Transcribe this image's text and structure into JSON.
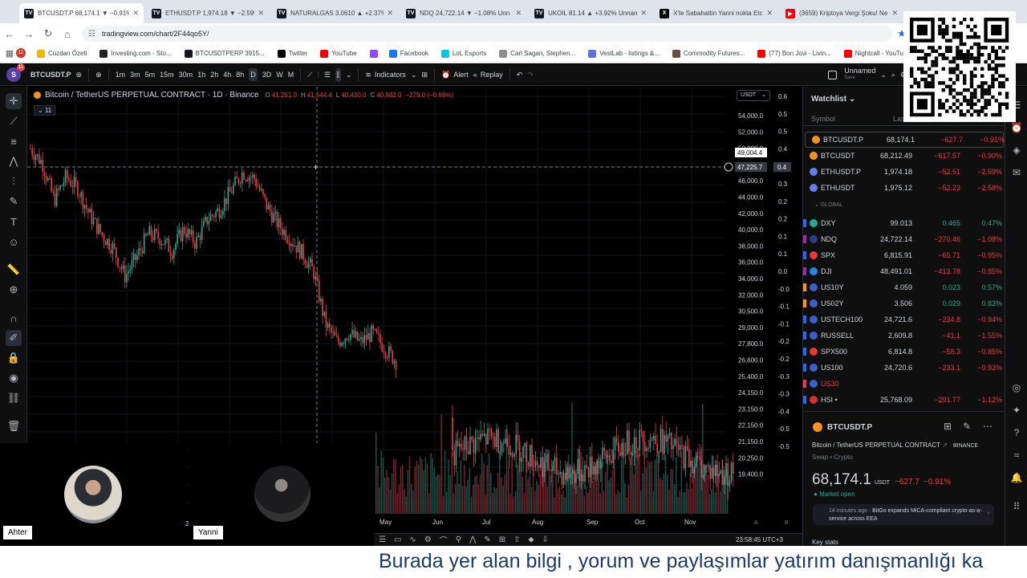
{
  "browser": {
    "tabs": [
      {
        "label": "BTCUSDT.P 68,174.1 ▼ −0.91%",
        "icon": "tradingview-icon",
        "active": true
      },
      {
        "label": "ETHUSDT.P 1,974.18 ▼ −2.59%",
        "icon": "tradingview-icon",
        "active": false
      },
      {
        "label": "NATURALGAS 3.0610 ▲ +2.37%",
        "icon": "tradingview-icon",
        "active": false
      },
      {
        "label": "NDQ 24,722.14 ▼ −1.08% Unn",
        "icon": "tradingview-icon",
        "active": false
      },
      {
        "label": "UKOIL 81.14 ▲ +3.92% Unnam",
        "icon": "tradingview-icon",
        "active": false
      },
      {
        "label": "X'te Sabahattin Yanni nokta Etc",
        "icon": "x-icon",
        "active": false
      },
      {
        "label": "(3659) Kriptoya Vergi Şoku! Ne",
        "icon": "youtube-icon",
        "active": false
      }
    ],
    "url": "tradingview.com/chart/2F44qo5Y/",
    "bookmarks": [
      "Cüzdan Özeti",
      "Investing.com - Sto...",
      "BTCUSDTPERP 3915...",
      "Twitter",
      "YouTube",
      "",
      "Facebook",
      "LoL Esports",
      "Carl Sagan, Stephen...",
      "VestLab - listings &...",
      "Commodity Futures...",
      "(77) Bon Jovi - Livin...",
      "Nightcall - YouTube"
    ],
    "notification_count": "11"
  },
  "toolbar": {
    "symbol": "BTCUSDT.P",
    "intervals": [
      "1m",
      "3m",
      "5m",
      "15m",
      "30m",
      "1h",
      "2h",
      "4h",
      "8h",
      "D",
      "3D",
      "W",
      "M"
    ],
    "selected_interval": "D",
    "indicators_label": "Indicators",
    "alert_label": "Alert",
    "replay_label": "Replay",
    "layout_name": "Unnamed",
    "layout_status": "Save"
  },
  "legend": {
    "title": "Bitcoin / TetherUS PERPETUAL CONTRACT · 1D · Binance",
    "o_label": "O",
    "o": "41,261.0",
    "h_label": "H",
    "h": "41,544.4",
    "l_label": "L",
    "l": "40,430.0",
    "c_label": "C",
    "c": "40,982.0",
    "change": "−279.0 (−0.68%)",
    "indicator_count": "11",
    "currency": "USDT"
  },
  "chart_data": {
    "type": "candlestick",
    "price_axis": [
      "54,000.0",
      "52,000.0",
      "50,000.0",
      "48,000.0",
      "46,000.0",
      "44,000.0",
      "42,000.0",
      "40,000.0",
      "38,000.0",
      "36,000.0",
      "34,000.0",
      "32,000.0",
      "30,500.0",
      "29,000.0",
      "27,800.0",
      "26,600.0",
      "25,400.0",
      "24,150.0",
      "23,150.0",
      "22,150.0",
      "21,150.0",
      "20,250.0",
      "19,400.0"
    ],
    "oscillator_axis": [
      "0.6",
      "0.5",
      "0.5",
      "0.4",
      "0.4",
      "0.3",
      "0.2",
      "0.2",
      "0.1",
      "0.1",
      "0.0",
      "-0.0",
      "-0.1",
      "-0.1",
      "-0.2",
      "-0.2",
      "-0.3",
      "-0.3",
      "-0.4",
      "-0.5",
      "-0.5"
    ],
    "crosshair_price": "49,004.4",
    "crosshair_value": "47,225.7",
    "crosshair_osc": "0.4",
    "time_axis": [
      "May",
      "Jun",
      "Jul",
      "Aug",
      "Sep",
      "Oct",
      "Nov"
    ],
    "clock": "23:58:45 UTC+3",
    "close_trend": [
      50000,
      48500,
      44500,
      47000,
      45800,
      43000,
      41000,
      39500,
      36500,
      38500,
      41000,
      40500,
      39200,
      41500,
      40000,
      42500,
      43500,
      45500,
      47500,
      46800,
      44000,
      42000,
      40500,
      39000,
      37000,
      31500,
      29500,
      30500,
      29500,
      30500,
      29000,
      27500
    ]
  },
  "watchlist": {
    "title": "Watchlist",
    "col_symbol": "Symbol",
    "col_last": "Last",
    "group_label": "GLOBAL",
    "rows": [
      {
        "symbol": "BTCUSDT.P",
        "last": "68,174.1",
        "chg": "−627.7",
        "pct": "−0.91%",
        "icon": "bitcoin-icon",
        "flag": "",
        "neg": true
      },
      {
        "symbol": "BTCUSDT",
        "last": "68,212.49",
        "chg": "−617.57",
        "pct": "−0.90%",
        "icon": "bitcoin-icon",
        "flag": "",
        "neg": true
      },
      {
        "symbol": "ETHUSDT.P",
        "last": "1,974.18",
        "chg": "−52.51",
        "pct": "−2.59%",
        "icon": "ethereum-icon",
        "flag": "",
        "neg": true
      },
      {
        "symbol": "ETHUSDT",
        "last": "1,975.12",
        "chg": "−52.23",
        "pct": "−2.58%",
        "icon": "ethereum-icon",
        "flag": "",
        "neg": true
      },
      {
        "symbol": "DXY",
        "last": "99.013",
        "chg": "0.465",
        "pct": "0.47%",
        "icon": "dollar-icon",
        "flag": "#2962ff",
        "neg": false
      },
      {
        "symbol": "NDQ",
        "last": "24,722.14",
        "chg": "−270.46",
        "pct": "−1.08%",
        "icon": "nasdaq-icon",
        "flag": "#9c27b0",
        "neg": true
      },
      {
        "symbol": "SPX",
        "last": "6,815.91",
        "chg": "−65.71",
        "pct": "−0.95%",
        "icon": "sp500-icon",
        "flag": "#2962ff",
        "neg": true
      },
      {
        "symbol": "DJI",
        "last": "48,491.01",
        "chg": "−413.78",
        "pct": "−0.85%",
        "icon": "dow-icon",
        "flag": "#9c27b0",
        "neg": true
      },
      {
        "symbol": "US10Y",
        "last": "4.059",
        "chg": "0.023",
        "pct": "0.57%",
        "icon": "us-flag-icon",
        "flag": "#ff9800",
        "neg": false
      },
      {
        "symbol": "US02Y",
        "last": "3.506",
        "chg": "0.029",
        "pct": "0.83%",
        "icon": "us-flag-icon",
        "flag": "#ff9800",
        "neg": false
      },
      {
        "symbol": "USTECH100",
        "last": "24,721.6",
        "chg": "−234.8",
        "pct": "−0.94%",
        "icon": "us-flag-icon",
        "flag": "#2962ff",
        "neg": true
      },
      {
        "symbol": "RUSSELL",
        "last": "2,609.8",
        "chg": "−41.1",
        "pct": "−1.55%",
        "icon": "us-flag-icon",
        "flag": "#2962ff",
        "neg": true
      },
      {
        "symbol": "SPX500",
        "last": "6,814.8",
        "chg": "−58.3",
        "pct": "−0.85%",
        "icon": "sp500-icon",
        "flag": "#2962ff",
        "neg": true
      },
      {
        "symbol": "US100",
        "last": "24,720.6",
        "chg": "−233.1",
        "pct": "−0.93%",
        "icon": "us-flag-icon",
        "flag": "#2962ff",
        "neg": true
      },
      {
        "symbol": "US30",
        "last": "",
        "chg": "",
        "pct": "",
        "icon": "us-flag-icon",
        "flag": "#f23645",
        "neg": true
      },
      {
        "symbol": "HSI •",
        "last": "25,768.09",
        "chg": "−291.77",
        "pct": "−1.12%",
        "icon": "hang-seng-icon",
        "flag": "#2962ff",
        "neg": true
      }
    ]
  },
  "detail": {
    "symbol": "BTCUSDT.P",
    "description": "Bitcoin / TetherUS PERPETUAL CONTRACT",
    "exchange": "BINANCE",
    "category": "Swap • Crypto",
    "price": "68,174.1",
    "currency": "USDT",
    "change": "−627.7",
    "change_pct": "−0.91%",
    "market_status": "Market open",
    "news_time": "14 minutes ago",
    "news_text": "BitGo expands MiCA-compliant crypto-as-a-service across EEA",
    "key_stats": "Key stats"
  },
  "webcams": {
    "left_name": "Ahter",
    "right_name": "Yanni",
    "right_partial": "2"
  },
  "ticker": {
    "text": "Burada yer alan bilgi , yorum ve paylaşımlar yatırım danışmanlığı ka"
  },
  "colors": {
    "up": "#22ab94",
    "down": "#f23645",
    "tv_bg": "#0f0f0f",
    "chart_bg": "#000000"
  }
}
